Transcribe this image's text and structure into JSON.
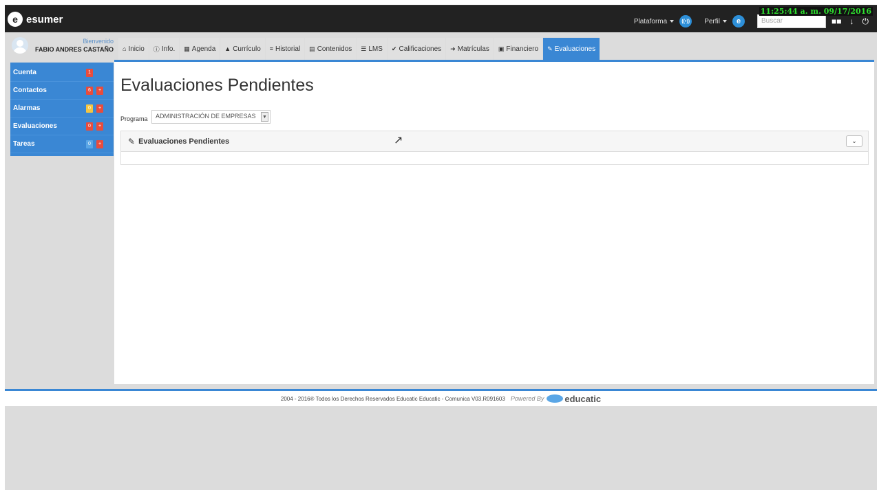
{
  "app": {
    "logo_glyph": "e",
    "name": "esumer"
  },
  "topnav": {
    "plataforma": "Plataforma",
    "perfil": "Perfil",
    "search_placeholder": "Buscar",
    "clock": "11:25:44 a. m. 09/17/2016"
  },
  "user": {
    "welcome": "Bienvenido",
    "name": "FABIO ANDRES CASTAÑO"
  },
  "sidebar": {
    "items": [
      {
        "label": "Cuenta",
        "badge1": "1",
        "badge1_color": "#e84c3d"
      },
      {
        "label": "Contactos",
        "badge1": "6",
        "badge1_color": "#e84c3d",
        "badge2": "+",
        "badge2_color": "#e84c3d"
      },
      {
        "label": "Alarmas",
        "badge1": "0",
        "badge1_color": "#f4c542",
        "badge2": "+",
        "badge2_color": "#e84c3d"
      },
      {
        "label": "Evaluaciones",
        "badge1": "0",
        "badge1_color": "#e84c3d",
        "badge2": "+",
        "badge2_color": "#e84c3d"
      },
      {
        "label": "Tareas",
        "badge1": "0",
        "badge1_color": "#5aa6e6",
        "badge2": "+",
        "badge2_color": "#e84c3d"
      }
    ]
  },
  "tabs": [
    {
      "icon": "home-icon",
      "label": "Inicio"
    },
    {
      "icon": "info-icon",
      "label": "Info."
    },
    {
      "icon": "calendar-icon",
      "label": "Agenda"
    },
    {
      "icon": "user-icon",
      "label": "Currículo"
    },
    {
      "icon": "history-icon",
      "label": "Historial"
    },
    {
      "icon": "content-icon",
      "label": "Contenidos"
    },
    {
      "icon": "list-icon",
      "label": "LMS"
    },
    {
      "icon": "check-circle-icon",
      "label": "Calificaciones"
    },
    {
      "icon": "sign-in-icon",
      "label": "Matrículas"
    },
    {
      "icon": "money-icon",
      "label": "Financiero"
    },
    {
      "icon": "pencil-icon",
      "label": "Evaluaciones",
      "active": true
    }
  ],
  "main": {
    "title": "Evaluaciones Pendientes",
    "programa_label": "Programa",
    "programa_value": "ADMINISTRACIÓN DE EMPRESAS",
    "panel_title": "Evaluaciones Pendientes"
  },
  "footer": {
    "copyright": "2004 - 2016® Todos los Derechos Reservados Educatic Educatic - Comunica V03.R091603",
    "powered_by": "Powered By",
    "brand": "educatic"
  },
  "colors": {
    "accent": "#3a87d4",
    "topbar": "#222222",
    "clock": "#2fe12f"
  }
}
